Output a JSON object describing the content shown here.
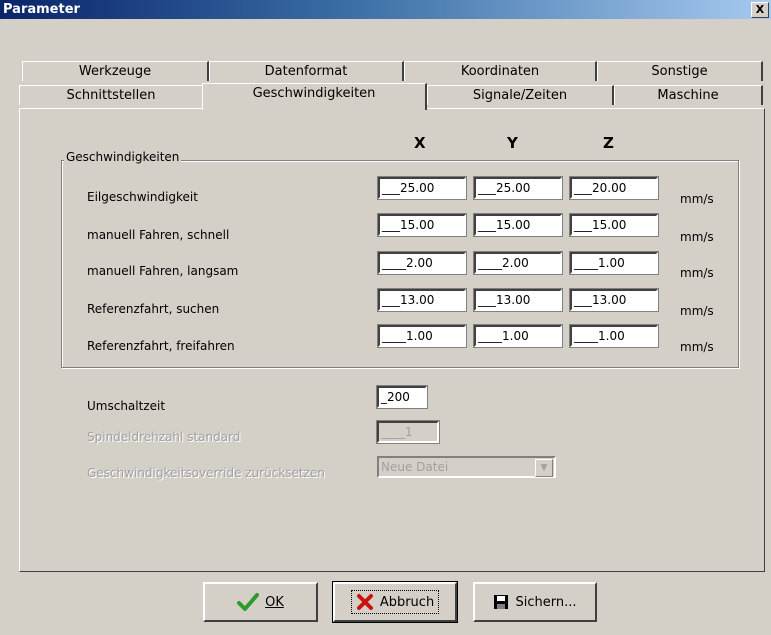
{
  "window": {
    "title": "Parameter",
    "close_glyph": "X"
  },
  "tabs_back": [
    {
      "label": "Werkzeuge"
    },
    {
      "label": "Datenformat"
    },
    {
      "label": "Koordinaten"
    },
    {
      "label": "Sonstige"
    }
  ],
  "tabs_front": [
    {
      "label": "Schnittstellen"
    },
    {
      "label": "Geschwindigkeiten"
    },
    {
      "label": "Signale/Zeiten"
    },
    {
      "label": "Maschine"
    }
  ],
  "columns": {
    "x": "X",
    "y": "Y",
    "z": "Z"
  },
  "group": {
    "label": "Geschwindigkeiten",
    "rows": [
      {
        "label": "Eilgeschwindigkeit",
        "x": "___25.00",
        "y": "___25.00",
        "z": "___20.00",
        "unit": "mm/s"
      },
      {
        "label": "manuell Fahren, schnell",
        "x": "___15.00",
        "y": "___15.00",
        "z": "___15.00",
        "unit": "mm/s"
      },
      {
        "label": "manuell Fahren, langsam",
        "x": "____2.00",
        "y": "____2.00",
        "z": "____1.00",
        "unit": "mm/s"
      },
      {
        "label": "Referenzfahrt, suchen",
        "x": "___13.00",
        "y": "___13.00",
        "z": "___13.00",
        "unit": "mm/s"
      },
      {
        "label": "Referenzfahrt, freifahren",
        "x": "____1.00",
        "y": "____1.00",
        "z": "____1.00",
        "unit": "mm/s"
      }
    ]
  },
  "umschaltzeit": {
    "label": "Umschaltzeit",
    "value": "_200"
  },
  "spindel": {
    "label": "Spindeldrehzahl standard",
    "value": "____1"
  },
  "override": {
    "label": "Geschwindigkeitsoverride zurücksetzen",
    "value": "Neue Datei"
  },
  "buttons": {
    "ok": "OK",
    "cancel": "Abbruch",
    "save": "Sichern..."
  },
  "colors": {
    "title_start": "#0a246a",
    "title_end": "#a6caf0",
    "ok_icon": "#2e9a2e",
    "cancel_icon": "#cc1111"
  }
}
